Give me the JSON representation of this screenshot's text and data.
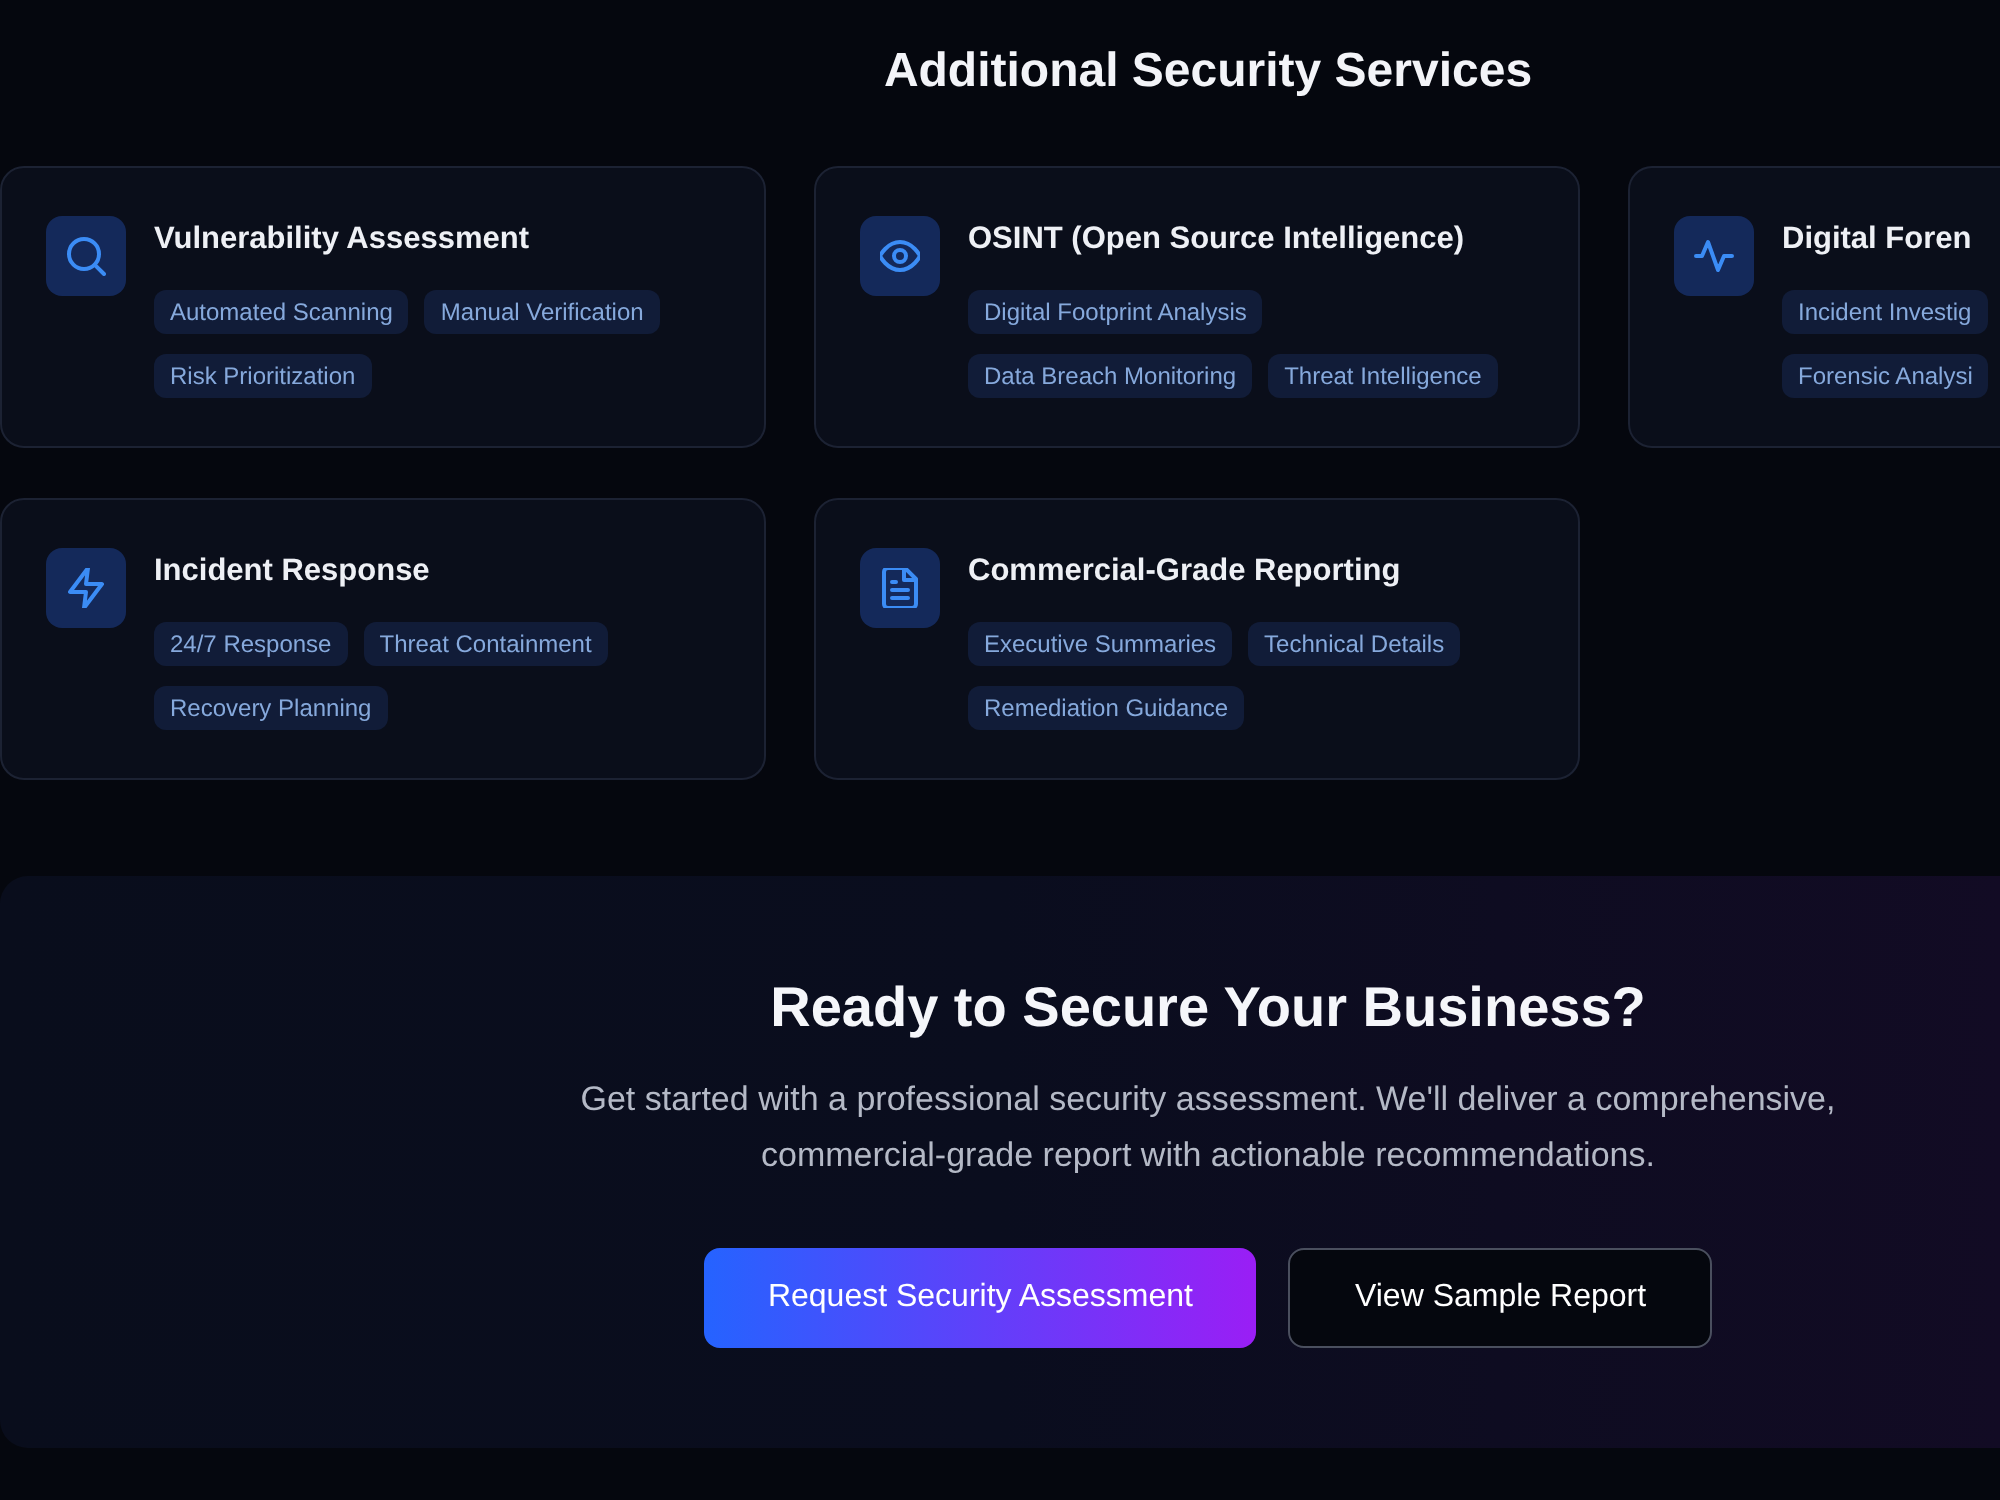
{
  "section_title": "Additional Security Services",
  "services": [
    {
      "title": "Vulnerability Assessment",
      "tags": [
        "Automated Scanning",
        "Manual Verification",
        "Risk Prioritization"
      ]
    },
    {
      "title": "OSINT (Open Source Intelligence)",
      "tags": [
        "Digital Footprint Analysis",
        "Data Breach Monitoring",
        "Threat Intelligence"
      ]
    },
    {
      "title": "Digital Foren",
      "tags": [
        "Incident Investig",
        "Forensic Analysi"
      ]
    },
    {
      "title": "Incident Response",
      "tags": [
        "24/7 Response",
        "Threat Containment",
        "Recovery Planning"
      ]
    },
    {
      "title": "Commercial-Grade Reporting",
      "tags": [
        "Executive Summaries",
        "Technical Details",
        "Remediation Guidance"
      ]
    }
  ],
  "cta": {
    "title": "Ready to Secure Your Business?",
    "text": "Get started with a professional security assessment. We'll deliver a comprehensive, commercial-grade report with actionable recommendations.",
    "buttons": [
      {
        "label": "Request Security Assessment",
        "kind": "primary"
      },
      {
        "label": "View Sample Report",
        "kind": "secondary"
      }
    ]
  }
}
